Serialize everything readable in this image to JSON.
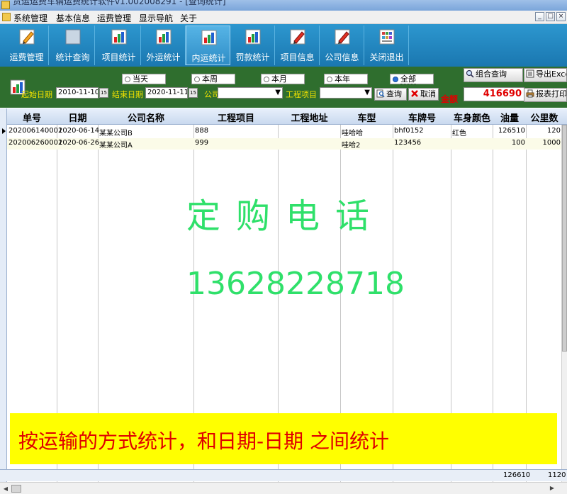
{
  "window": {
    "title": "货运运费车辆运费统计软件v1.002008291 - [查询统计]",
    "buttons": [
      "_",
      "□",
      "×"
    ]
  },
  "menu": {
    "items": [
      "系统管理",
      "基本信息",
      "运费管理",
      "显示导航",
      "关于"
    ]
  },
  "toolbar": {
    "buttons": [
      {
        "label": "运费管理",
        "icon": "pencil-icon",
        "active": false
      },
      {
        "label": "统计查询",
        "icon": "blank-board-icon",
        "active": false
      },
      {
        "label": "项目统计",
        "icon": "bar-chart-icon",
        "active": false
      },
      {
        "label": "外运统计",
        "icon": "bar-chart-icon",
        "active": false
      },
      {
        "label": "内运统计",
        "icon": "bar-chart-icon",
        "active": true
      },
      {
        "label": "罚款统计",
        "icon": "bar-chart-icon",
        "active": false
      },
      {
        "label": "项目信息",
        "icon": "pencil-icon",
        "active": false
      },
      {
        "label": "公司信息",
        "icon": "pencil-icon",
        "active": false
      },
      {
        "label": "关闭退出",
        "icon": "grid-icon",
        "active": false
      }
    ]
  },
  "filter": {
    "start_label": "起始日期",
    "start_value": "2010-11-10",
    "end_label": "结束日期",
    "end_value": "2020-11-11",
    "calendar_icon_text": "15",
    "company_label": "公司",
    "company_value": "",
    "project_label": "工程项目",
    "project_value": "",
    "radios": [
      {
        "label": "当天",
        "selected": false
      },
      {
        "label": "本周",
        "selected": false
      },
      {
        "label": "本月",
        "selected": false
      },
      {
        "label": "本年",
        "selected": false
      },
      {
        "label": "全部",
        "selected": true
      }
    ],
    "query_button": "查询",
    "cancel_button": "取消",
    "combo_query_button": "组合查询",
    "export_button": "导出Excel",
    "print_button": "报表打印",
    "amount_label": "金额",
    "amount_value": "416690"
  },
  "grid": {
    "columns": [
      "单号",
      "日期",
      "公司名称",
      "工程项目",
      "工程地址",
      "车型",
      "车牌号",
      "车身颜色",
      "油量",
      "公里数"
    ],
    "rows": [
      [
        "202006140001",
        "2020-06-14",
        "某某公司B",
        "888",
        "",
        "哇哈哈",
        "bhf0152",
        "红色",
        "126510",
        "120"
      ],
      [
        "202006260001",
        "2020-06-26",
        "某某公司A",
        "999",
        "",
        "哇哈2",
        "123456",
        "",
        "100",
        "1000"
      ]
    ],
    "totals": {
      "油量": "126610",
      "公里数": "1120"
    }
  },
  "overlay": {
    "line1": "定购电话",
    "line2": "13628228718",
    "notice": "按运输的方式统计，和日期-日期 之间统计"
  },
  "colors": {
    "toolbar_bg": "#1f86c0",
    "filter_bg": "#2f6e2e",
    "filter_label": "#f2e200",
    "watermark": "#2fe06a",
    "notice_bg": "#ffff00",
    "notice_text": "#e00000",
    "amount_text": "#e00000"
  }
}
